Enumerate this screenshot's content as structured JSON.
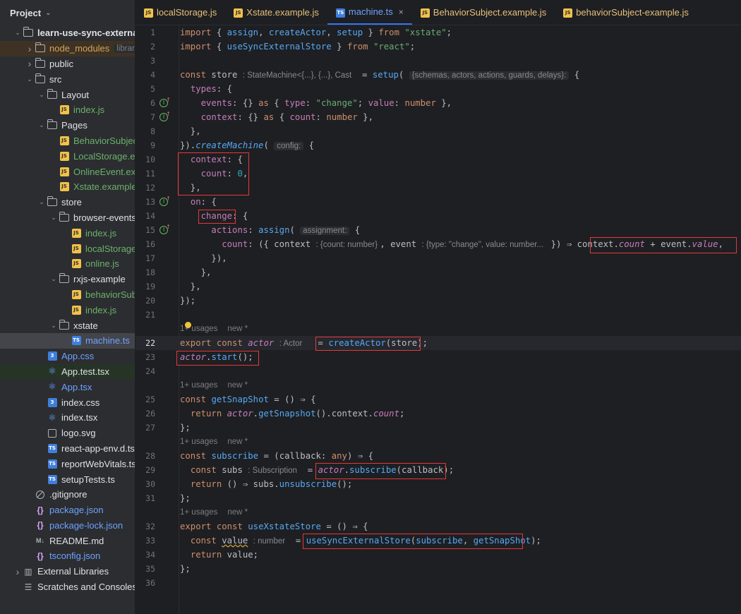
{
  "sidebar": {
    "title": "Project",
    "items": [
      {
        "label": "learn-use-sync-external",
        "icon": "folder-icon",
        "level": 0,
        "arrow": "open",
        "style": "plain",
        "bold": true
      },
      {
        "label": "node_modules",
        "hint": "library root",
        "icon": "folder-icon",
        "level": 1,
        "arrow": "closed",
        "style": "excluded"
      },
      {
        "label": "public",
        "icon": "folder-icon",
        "level": 1,
        "arrow": "closed",
        "style": "plain"
      },
      {
        "label": "src",
        "icon": "folder-icon",
        "level": 1,
        "arrow": "open",
        "style": "plain"
      },
      {
        "label": "Layout",
        "icon": "folder-icon",
        "level": 2,
        "arrow": "open",
        "style": "plain"
      },
      {
        "label": "index.js",
        "icon": "js-file-icon",
        "level": 3,
        "arrow": "none",
        "style": "js-green"
      },
      {
        "label": "Pages",
        "icon": "folder-icon",
        "level": 2,
        "arrow": "open",
        "style": "plain"
      },
      {
        "label": "BehaviorSubject",
        "icon": "js-file-icon",
        "level": 3,
        "arrow": "none",
        "style": "js-green"
      },
      {
        "label": "LocalStorage.ex",
        "icon": "js-file-icon",
        "level": 3,
        "arrow": "none",
        "style": "js-green"
      },
      {
        "label": "OnlineEvent.exa",
        "icon": "js-file-icon",
        "level": 3,
        "arrow": "none",
        "style": "js-green"
      },
      {
        "label": "Xstate.example.",
        "icon": "js-file-icon",
        "level": 3,
        "arrow": "none",
        "style": "js-green"
      },
      {
        "label": "store",
        "icon": "folder-icon",
        "level": 2,
        "arrow": "open",
        "style": "plain"
      },
      {
        "label": "browser-events",
        "icon": "folder-icon",
        "level": 3,
        "arrow": "open",
        "style": "plain"
      },
      {
        "label": "index.js",
        "icon": "js-file-icon",
        "level": 4,
        "arrow": "none",
        "style": "js-green"
      },
      {
        "label": "localStorage.",
        "icon": "js-file-icon",
        "level": 4,
        "arrow": "none",
        "style": "js-green"
      },
      {
        "label": "online.js",
        "icon": "js-file-icon",
        "level": 4,
        "arrow": "none",
        "style": "js-green"
      },
      {
        "label": "rxjs-example",
        "icon": "folder-icon",
        "level": 3,
        "arrow": "open",
        "style": "plain"
      },
      {
        "label": "behaviorSubj",
        "icon": "js-file-icon",
        "level": 4,
        "arrow": "none",
        "style": "js-green"
      },
      {
        "label": "index.js",
        "icon": "js-file-icon",
        "level": 4,
        "arrow": "none",
        "style": "js-green"
      },
      {
        "label": "xstate",
        "icon": "folder-icon",
        "level": 3,
        "arrow": "open",
        "style": "plain"
      },
      {
        "label": "machine.ts",
        "icon": "ts-file-icon",
        "level": 4,
        "arrow": "none",
        "style": "blue",
        "selected": true
      },
      {
        "label": "App.css",
        "icon": "css-file-icon",
        "level": 2,
        "arrow": "none",
        "style": "blue"
      },
      {
        "label": "App.test.tsx",
        "icon": "react-file-icon",
        "level": 2,
        "arrow": "none",
        "style": "plain",
        "modified": true
      },
      {
        "label": "App.tsx",
        "icon": "react-file-icon",
        "level": 2,
        "arrow": "none",
        "style": "blue"
      },
      {
        "label": "index.css",
        "icon": "css-file-icon",
        "level": 2,
        "arrow": "none",
        "style": "plain"
      },
      {
        "label": "index.tsx",
        "icon": "react-file-icon",
        "level": 2,
        "arrow": "none",
        "style": "plain"
      },
      {
        "label": "logo.svg",
        "icon": "svg-file-icon",
        "level": 2,
        "arrow": "none",
        "style": "plain"
      },
      {
        "label": "react-app-env.d.ts",
        "icon": "ts-file-icon",
        "level": 2,
        "arrow": "none",
        "style": "plain"
      },
      {
        "label": "reportWebVitals.ts",
        "icon": "ts-file-icon",
        "level": 2,
        "arrow": "none",
        "style": "plain"
      },
      {
        "label": "setupTests.ts",
        "icon": "ts-file-icon",
        "level": 2,
        "arrow": "none",
        "style": "plain"
      },
      {
        "label": ".gitignore",
        "icon": "gitignore-file-icon",
        "level": 1,
        "arrow": "none",
        "style": "plain"
      },
      {
        "label": "package.json",
        "icon": "json-file-icon",
        "level": 1,
        "arrow": "none",
        "style": "blue"
      },
      {
        "label": "package-lock.json",
        "icon": "json-file-icon",
        "level": 1,
        "arrow": "none",
        "style": "blue"
      },
      {
        "label": "README.md",
        "icon": "markdown-file-icon",
        "level": 1,
        "arrow": "none",
        "style": "plain"
      },
      {
        "label": "tsconfig.json",
        "icon": "json-file-icon",
        "level": 1,
        "arrow": "none",
        "style": "blue"
      },
      {
        "label": "External Libraries",
        "icon": "library-icon",
        "level": 0,
        "arrow": "closed",
        "style": "plain"
      },
      {
        "label": "Scratches and Consoles",
        "icon": "scratches-icon",
        "level": 0,
        "arrow": "none",
        "style": "plain"
      }
    ]
  },
  "tabs": [
    {
      "label": "localStorage.js",
      "badge": "JS",
      "style": "js-yellow",
      "active": false
    },
    {
      "label": "Xstate.example.js",
      "badge": "JS",
      "style": "js-yellow",
      "active": false
    },
    {
      "label": "machine.ts",
      "badge": "TS",
      "style": "ts",
      "active": true,
      "close": "×"
    },
    {
      "label": "BehaviorSubject.example.js",
      "badge": "JS",
      "style": "js-yellow",
      "active": false
    },
    {
      "label": "behaviorSubject-example.js",
      "badge": "JS",
      "style": "js-yellow",
      "active": false
    }
  ],
  "editor": {
    "current_line": 22,
    "line_count": 36,
    "usages": [
      {
        "before_line": 22,
        "text": "1+ usages",
        "new": "new *"
      },
      {
        "before_line": 25,
        "text": "1+ usages",
        "new": "new *"
      },
      {
        "before_line": 28,
        "text": "1+ usages",
        "new": "new *"
      },
      {
        "before_line": 32,
        "text": "1+ usages",
        "new": "new *"
      }
    ],
    "gutter_marks": [
      6,
      7,
      13,
      15
    ],
    "lines": {
      "1": [
        [
          "kw",
          "import"
        ],
        [
          "def",
          " { "
        ],
        [
          "fn",
          "assign"
        ],
        [
          "def",
          ", "
        ],
        [
          "fn",
          "createActor"
        ],
        [
          "def",
          ", "
        ],
        [
          "fn",
          "setup"
        ],
        [
          "def",
          " } "
        ],
        [
          "kw",
          "from"
        ],
        [
          "def",
          " "
        ],
        [
          "str",
          "\"xstate\""
        ],
        [
          "def",
          ";"
        ]
      ],
      "2": [
        [
          "kw",
          "import"
        ],
        [
          "def",
          " { "
        ],
        [
          "fn",
          "useSyncExternalStore"
        ],
        [
          "def",
          " } "
        ],
        [
          "kw",
          "from"
        ],
        [
          "def",
          " "
        ],
        [
          "str",
          "\"react\""
        ],
        [
          "def",
          ";"
        ]
      ],
      "3": [],
      "4": [
        [
          "kw",
          "const"
        ],
        [
          "def",
          " store "
        ],
        [
          "hintplain",
          ": StateMachine<{...}, {...}, Cast"
        ],
        [
          "def",
          "  = "
        ],
        [
          "fn",
          "setup"
        ],
        [
          "def",
          "( "
        ],
        [
          "hint",
          "{schemas, actors, actions, guards, delays}:"
        ],
        [
          "def",
          " {"
        ]
      ],
      "5": [
        [
          "def",
          "  "
        ],
        [
          "prop",
          "types"
        ],
        [
          "def",
          ": {"
        ]
      ],
      "6": [
        [
          "def",
          "    "
        ],
        [
          "prop",
          "events"
        ],
        [
          "def",
          ": {} "
        ],
        [
          "kw",
          "as"
        ],
        [
          "def",
          " { "
        ],
        [
          "prop",
          "type"
        ],
        [
          "def",
          ": "
        ],
        [
          "str",
          "\"change\""
        ],
        [
          "def",
          "; "
        ],
        [
          "prop",
          "value"
        ],
        [
          "def",
          ": "
        ],
        [
          "kw",
          "number"
        ],
        [
          "def",
          " },"
        ]
      ],
      "7": [
        [
          "def",
          "    "
        ],
        [
          "prop",
          "context"
        ],
        [
          "def",
          ": {} "
        ],
        [
          "kw",
          "as"
        ],
        [
          "def",
          " { "
        ],
        [
          "prop",
          "count"
        ],
        [
          "def",
          ": "
        ],
        [
          "kw",
          "number"
        ],
        [
          "def",
          " },"
        ]
      ],
      "8": [
        [
          "def",
          "  },"
        ]
      ],
      "9": [
        [
          "def",
          "})."
        ],
        [
          "fn ital",
          "createMachine"
        ],
        [
          "def",
          "( "
        ],
        [
          "hint",
          "config:"
        ],
        [
          "def",
          " {"
        ]
      ],
      "10": [
        [
          "def",
          "  "
        ],
        [
          "prop",
          "context"
        ],
        [
          "def",
          ": {"
        ]
      ],
      "11": [
        [
          "def",
          "    "
        ],
        [
          "prop",
          "count"
        ],
        [
          "def",
          ": "
        ],
        [
          "num",
          "0"
        ],
        [
          "def",
          ","
        ]
      ],
      "12": [
        [
          "def",
          "  },"
        ]
      ],
      "13": [
        [
          "def",
          "  "
        ],
        [
          "prop",
          "on"
        ],
        [
          "def",
          ": {"
        ]
      ],
      "14": [
        [
          "def",
          "    "
        ],
        [
          "prop",
          "change"
        ],
        [
          "def",
          ": {"
        ]
      ],
      "15": [
        [
          "def",
          "      "
        ],
        [
          "prop",
          "actions"
        ],
        [
          "def",
          ": "
        ],
        [
          "fn",
          "assign"
        ],
        [
          "def",
          "( "
        ],
        [
          "hint",
          "assignment:"
        ],
        [
          "def",
          " {"
        ]
      ],
      "16": [
        [
          "def",
          "        "
        ],
        [
          "prop",
          "count"
        ],
        [
          "def",
          ": ({ context "
        ],
        [
          "hintplain",
          ": {count: number} "
        ],
        [
          "def",
          ", event "
        ],
        [
          "hintplain",
          ": {type: \"change\", value: number... "
        ],
        [
          "def",
          " }) ⇒ context."
        ],
        [
          "prop ital",
          "count"
        ],
        [
          "def",
          " + event."
        ],
        [
          "prop ital",
          "value"
        ],
        [
          "def",
          ","
        ]
      ],
      "17": [
        [
          "def",
          "      }),"
        ]
      ],
      "18": [
        [
          "def",
          "    },"
        ]
      ],
      "19": [
        [
          "def",
          "  },"
        ]
      ],
      "20": [
        [
          "def",
          "});"
        ]
      ],
      "21": [],
      "22": [
        [
          "kw",
          "export"
        ],
        [
          "def",
          " "
        ],
        [
          "kw",
          "const"
        ],
        [
          "def",
          " "
        ],
        [
          "prop ital",
          "actor"
        ],
        [
          "def",
          " "
        ],
        [
          "hintplain",
          ": Actor"
        ],
        [
          "def",
          "   = "
        ],
        [
          "fn",
          "createActor"
        ],
        [
          "def",
          "(store);"
        ]
      ],
      "23": [
        [
          "prop ital",
          "actor"
        ],
        [
          "def",
          "."
        ],
        [
          "fn",
          "start"
        ],
        [
          "def",
          "();"
        ]
      ],
      "24": [],
      "25": [
        [
          "kw",
          "const"
        ],
        [
          "def",
          " "
        ],
        [
          "fn",
          "getSnapShot"
        ],
        [
          "def",
          " = () ⇒ {"
        ]
      ],
      "26": [
        [
          "def",
          "  "
        ],
        [
          "kw",
          "return"
        ],
        [
          "def",
          " "
        ],
        [
          "prop ital",
          "actor"
        ],
        [
          "def",
          "."
        ],
        [
          "fn",
          "getSnapshot"
        ],
        [
          "def",
          "().context."
        ],
        [
          "prop ital",
          "count"
        ],
        [
          "def",
          ";"
        ]
      ],
      "27": [
        [
          "def",
          "};"
        ]
      ],
      "28": [
        [
          "kw",
          "const"
        ],
        [
          "def",
          " "
        ],
        [
          "fn",
          "subscribe"
        ],
        [
          "def",
          " = (callback: "
        ],
        [
          "kw",
          "any"
        ],
        [
          "def",
          ") ⇒ {"
        ]
      ],
      "29": [
        [
          "def",
          "  "
        ],
        [
          "kw",
          "const"
        ],
        [
          "def",
          " subs "
        ],
        [
          "hintplain",
          ": Subscription"
        ],
        [
          "def",
          "  = "
        ],
        [
          "prop ital",
          "actor"
        ],
        [
          "def",
          "."
        ],
        [
          "fn",
          "subscribe"
        ],
        [
          "def",
          "(callback);"
        ]
      ],
      "30": [
        [
          "def",
          "  "
        ],
        [
          "kw",
          "return"
        ],
        [
          "def",
          " () ⇒ subs."
        ],
        [
          "fn",
          "unsubscribe"
        ],
        [
          "def",
          "();"
        ]
      ],
      "31": [
        [
          "def",
          "};"
        ]
      ],
      "32": [
        [
          "kw",
          "export"
        ],
        [
          "def",
          " "
        ],
        [
          "kw",
          "const"
        ],
        [
          "def",
          " "
        ],
        [
          "fn",
          "useXstateStore"
        ],
        [
          "def",
          " = () ⇒ {"
        ]
      ],
      "33": [
        [
          "def",
          "  "
        ],
        [
          "kw",
          "const"
        ],
        [
          "def",
          " "
        ],
        [
          "squiggle",
          "value"
        ],
        [
          "def",
          " "
        ],
        [
          "hintplain",
          ": number"
        ],
        [
          "def",
          "  = "
        ],
        [
          "fn",
          "useSyncExternalStore"
        ],
        [
          "def",
          "("
        ],
        [
          "fn",
          "subscribe"
        ],
        [
          "def",
          ", "
        ],
        [
          "fn",
          "getSnapShot"
        ],
        [
          "def",
          ");"
        ]
      ],
      "34": [
        [
          "def",
          "  "
        ],
        [
          "kw",
          "return"
        ],
        [
          "def",
          " value;"
        ]
      ],
      "35": [
        [
          "def",
          "};"
        ]
      ],
      "36": []
    }
  },
  "colors": {
    "background": "#1e1f22",
    "sidebar": "#2b2d30",
    "keyword": "#cf8e6d",
    "function": "#56a8f5",
    "string": "#6aab73",
    "number": "#2aacb8",
    "property": "#c77dbb",
    "annotation_box": "#e5383b"
  }
}
